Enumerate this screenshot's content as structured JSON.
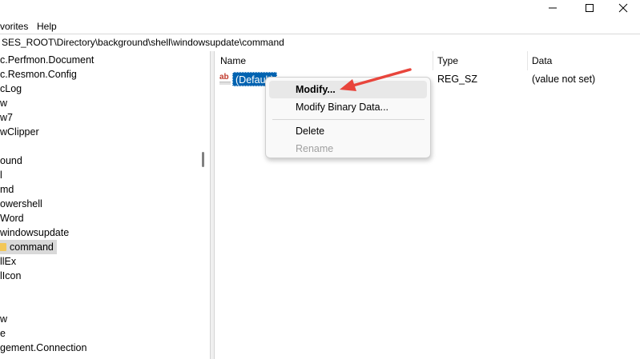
{
  "window": {
    "minimize_icon": "minimize-icon",
    "maximize_icon": "maximize-icon",
    "close_icon": "close-icon"
  },
  "menu": {
    "favorites": "vorites",
    "help": "Help"
  },
  "address": "SES_ROOT\\Directory\\background\\shell\\windowsupdate\\command",
  "tree": {
    "items": [
      "c.Perfmon.Document",
      "c.Resmon.Config",
      "cLog",
      "w",
      "w7",
      "wClipper",
      "",
      "ound",
      "l",
      "md",
      "owershell",
      "Word",
      "windowsupdate",
      "command",
      "llEx",
      "lIcon",
      "",
      "",
      "w",
      "e",
      "gement.Connection"
    ]
  },
  "list": {
    "headers": {
      "name": "Name",
      "type": "Type",
      "data": "Data"
    },
    "rows": [
      {
        "name": "(Default)",
        "type": "REG_SZ",
        "data": "(value not set)"
      }
    ]
  },
  "context_menu": {
    "items": {
      "modify": "Modify...",
      "modify_binary": "Modify Binary Data...",
      "delete": "Delete",
      "rename": "Rename"
    }
  },
  "colors": {
    "selection": "#0063b1",
    "arrow": "#e8453c",
    "folder": "#f3c758"
  }
}
